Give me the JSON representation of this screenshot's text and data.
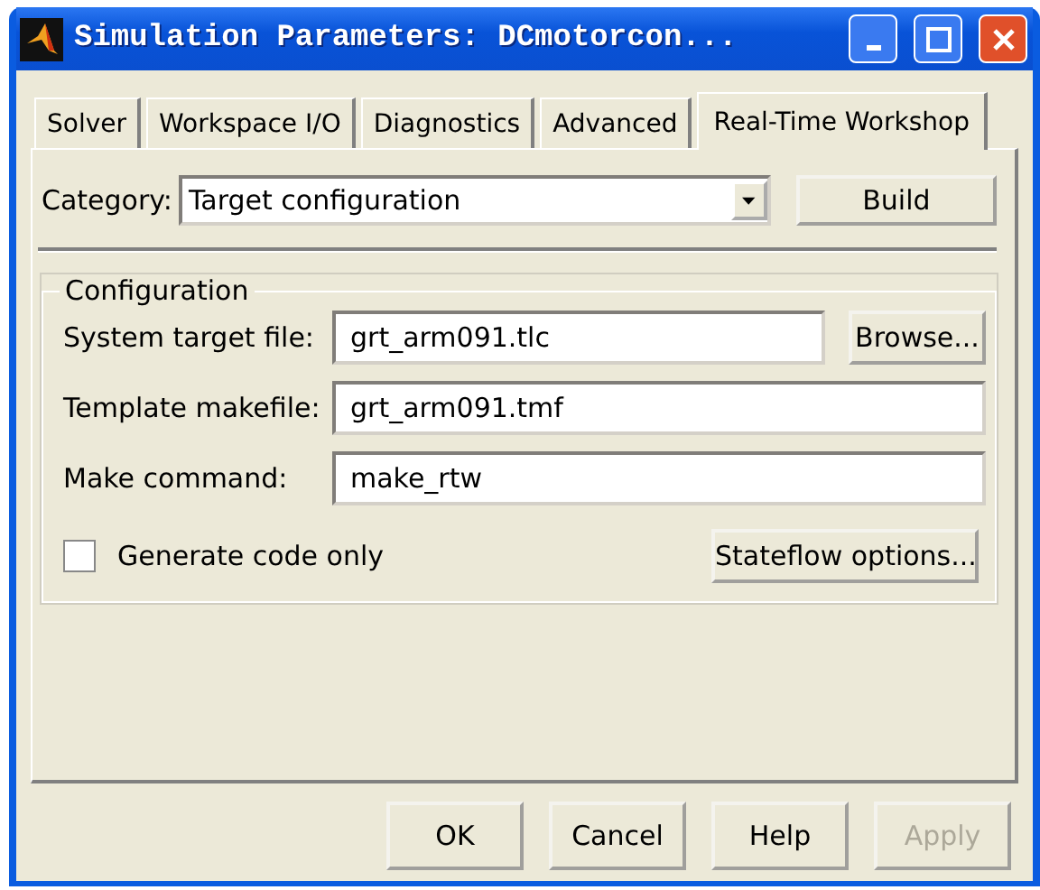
{
  "window": {
    "title": "Simulation Parameters: DCmotorcon..."
  },
  "tabs": [
    {
      "label": "Solver",
      "selected": false
    },
    {
      "label": "Workspace I/O",
      "selected": false
    },
    {
      "label": "Diagnostics",
      "selected": false
    },
    {
      "label": "Advanced",
      "selected": false
    },
    {
      "label": "Real-Time Workshop",
      "selected": true
    }
  ],
  "category": {
    "label": "Category:",
    "value": "Target configuration",
    "button": "Build"
  },
  "configuration": {
    "title": "Configuration",
    "fields": [
      {
        "label": "System target file:",
        "value": "grt_arm091.tlc",
        "button": "Browse..."
      },
      {
        "label": "Template makefile:",
        "value": "grt_arm091.tmf"
      },
      {
        "label": "Make command:",
        "value": "make_rtw"
      }
    ],
    "checkbox": {
      "label": "Generate code only",
      "checked": false
    },
    "options_button": "Stateflow options..."
  },
  "buttons": [
    {
      "label": "OK",
      "disabled": false
    },
    {
      "label": "Cancel",
      "disabled": false
    },
    {
      "label": "Help",
      "disabled": false
    },
    {
      "label": "Apply",
      "disabled": true
    }
  ]
}
